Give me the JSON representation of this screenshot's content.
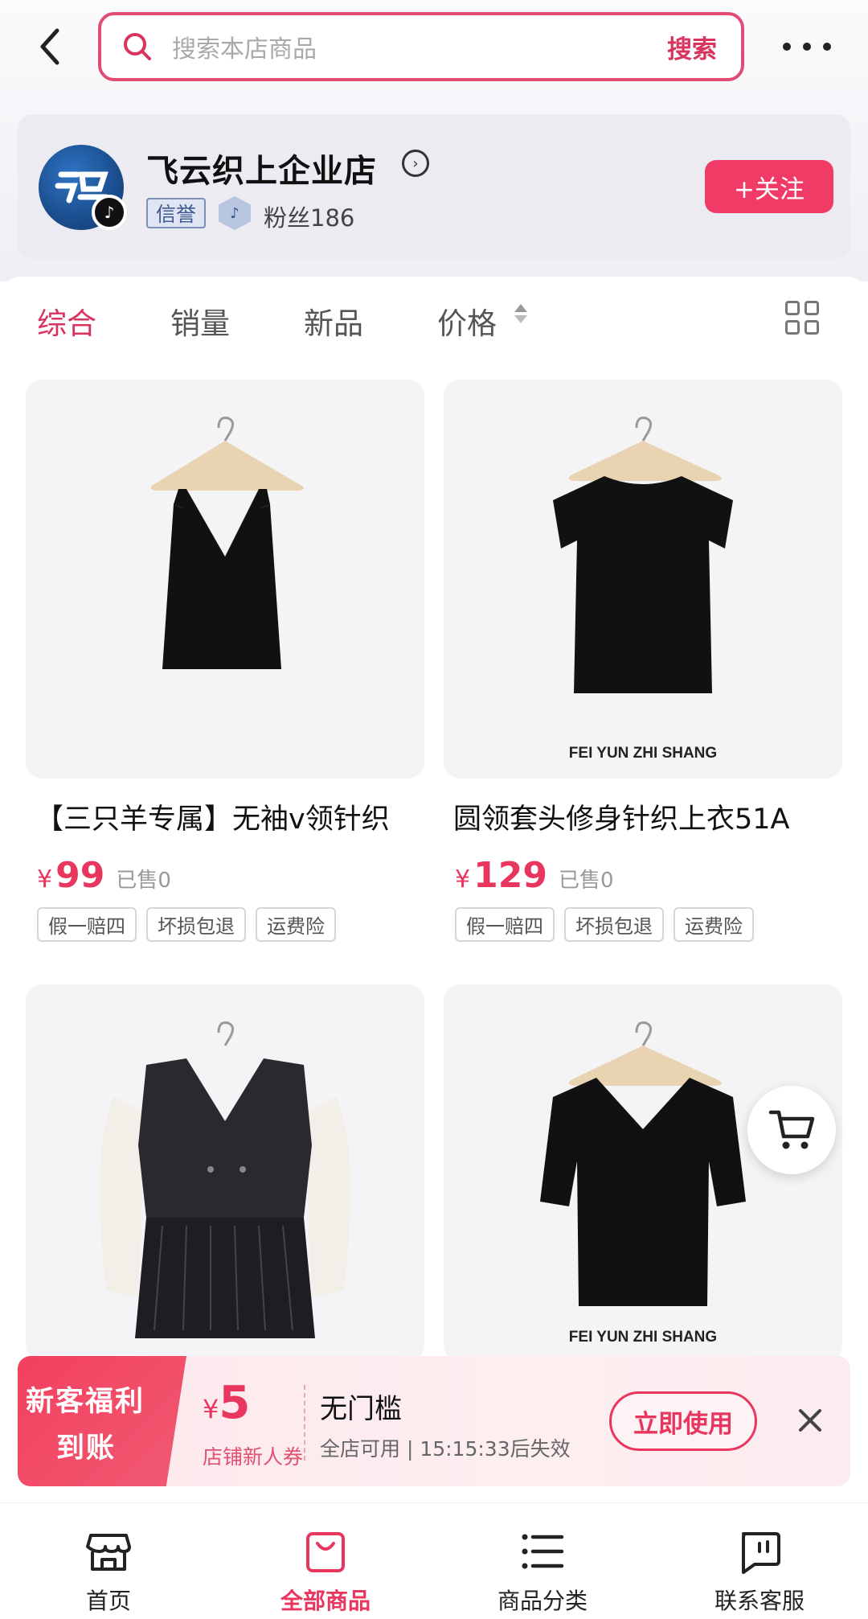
{
  "header": {
    "search_placeholder": "搜索本店商品",
    "search_button": "搜索"
  },
  "shop": {
    "name": "飞云织上企业店",
    "credit_badge": "信誉",
    "fans": "粉丝186",
    "follow_button": "+关注"
  },
  "sort": {
    "tabs": [
      "综合",
      "销量",
      "新品",
      "价格"
    ],
    "active_tab": "综合"
  },
  "products": [
    {
      "title": "【三只羊专属】无袖v领针织",
      "currency": "¥",
      "price": "99",
      "sold": "已售0",
      "tags": [
        "假一赔四",
        "坏损包退",
        "运费险"
      ]
    },
    {
      "title": "圆领套头修身针织上衣51A",
      "currency": "¥",
      "price": "129",
      "sold": "已售0",
      "tags": [
        "假一赔四",
        "坏损包退",
        "运费险"
      ],
      "brand_text": "FEI YUN ZHI SHANG"
    },
    {
      "title": ""
    },
    {
      "title": "",
      "brand_text": "FEI YUN ZHI SHANG"
    }
  ],
  "coupon": {
    "badge_line1": "新客福利",
    "badge_line2": "到账",
    "currency": "¥",
    "amount": "5",
    "subtitle": "店铺新人券",
    "title": "无门槛",
    "desc": "全店可用 | 15:15:33后失效",
    "use_button": "立即使用"
  },
  "bottom_nav": [
    {
      "label": "首页",
      "icon": "shop-home-icon"
    },
    {
      "label": "全部商品",
      "icon": "shopping-bag-icon"
    },
    {
      "label": "商品分类",
      "icon": "list-icon"
    },
    {
      "label": "联系客服",
      "icon": "chat-icon"
    }
  ],
  "colors": {
    "accent": "#e8365f",
    "follow_bg": "#ef3b65"
  }
}
